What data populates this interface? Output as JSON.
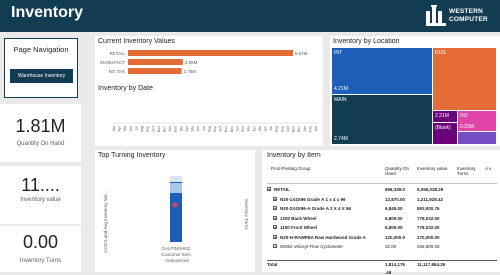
{
  "header": {
    "title": "Inventory",
    "logo_line1": "WESTERN",
    "logo_line2": "COMPUTER"
  },
  "nav": {
    "title": "Page Navigation",
    "button_label": "Warehouse Inventory"
  },
  "kpis": [
    {
      "value": "1.81M",
      "label": "Quantity On Hand"
    },
    {
      "value": "11....",
      "label": "Inventory value"
    },
    {
      "value": "0.00",
      "label": "Inventory Turns"
    }
  ],
  "current_inventory": {
    "title": "Current Inventory Values",
    "chart_data": {
      "type": "bar",
      "categories": [
        "RETAIL",
        "MANUFACT",
        "NO TAX"
      ],
      "values": [
        8.57,
        2.85,
        2.78
      ],
      "value_labels": [
        "8.57M",
        "2.85M",
        "2.78M"
      ],
      "color": "#e66c37"
    }
  },
  "inventory_by_date": {
    "title": "Inventory by Date",
    "chart_data": {
      "type": "bar",
      "categories": [
        "Ma",
        "Apr",
        "Ma",
        "Jun",
        "Jul",
        "Aug",
        "Sep",
        "Oct",
        "Nov",
        "Dec",
        "Jan",
        "Feb",
        "Ma",
        "Apr",
        "Ma",
        "Jun",
        "Jul",
        "Aug",
        "Sep",
        "Oct",
        "Nov",
        "Dec",
        "Jan",
        "Feb",
        "Ma",
        "Apr",
        "Ma",
        "Jun",
        "Jul",
        "Aug",
        "Sep",
        "Oct",
        "Nov",
        "Dec",
        "Jan",
        "Feb",
        "Ma"
      ]
    }
  },
  "inventory_by_location": {
    "title": "Inventory by Location",
    "tiles": [
      {
        "name": "INT",
        "value": "4.21M",
        "color": "#1d5eb8"
      },
      {
        "name": "MAIN",
        "value": "2.74M",
        "color": "#123c52"
      },
      {
        "name": "RUS",
        "value": "",
        "color": "#e66c37"
      },
      {
        "name": "",
        "value": "2.21M",
        "color": "#6b007b"
      },
      {
        "name": "(Blank)",
        "value": "",
        "color": "#6b007b"
      },
      {
        "name": "NO",
        "value": "0.20M",
        "color": "#e044a7"
      },
      {
        "name": "",
        "value": "",
        "color": "#744ec2"
      }
    ]
  },
  "top_turning": {
    "title": "Top Turning Inventory",
    "ylabel": "COGS and Avg Inventory Val...",
    "y2label": "Inventory Turns",
    "category_label": "GALPINSHED Customer Item - Galvanized"
  },
  "inventory_by_item": {
    "title": "Inventory by Item",
    "columns": [
      "Prod Posting Group",
      "Quantity On Hand",
      "Inventory value",
      "Inventory Turns",
      "A v"
    ],
    "rows": [
      {
        "name": "RETAIL",
        "qty": "698,339.0",
        "val": "6,066,038.29",
        "bold": true,
        "indent": 0
      },
      {
        "name": "N20-1X4X96 Grade A 1 x 4 x 96",
        "qty": "12,870.00",
        "val": "1,211,928.42",
        "bold": true,
        "indent": 1
      },
      {
        "name": "N20-2X4X96-A Grade A 2 X 4 X 96",
        "qty": "6,845.00",
        "val": "893,930.76",
        "bold": true,
        "indent": 1
      },
      {
        "name": "1200 Back Wheel",
        "qty": "6,800.00",
        "val": "778,032.00",
        "bold": true,
        "indent": 1
      },
      {
        "name": "1100 Front Wheel",
        "qty": "6,800.00",
        "val": "778,032.00",
        "bold": true,
        "indent": 1
      },
      {
        "name": "N20-H-RAWP8A Raw Hardwood Grade A",
        "qty": "120,000.0",
        "val": "270,000.00",
        "bold": true,
        "indent": 1
      },
      {
        "name": "00082 Velocyt Flow Cyclometer",
        "qty": "32.00",
        "val": "268,800.00",
        "bold": false,
        "indent": 1
      },
      {
        "name": "Total",
        "qty": "1,814,176",
        "val": "11,117,864.26",
        "bold": true,
        "indent": 0
      }
    ],
    "total_qty_cont": ".49"
  }
}
